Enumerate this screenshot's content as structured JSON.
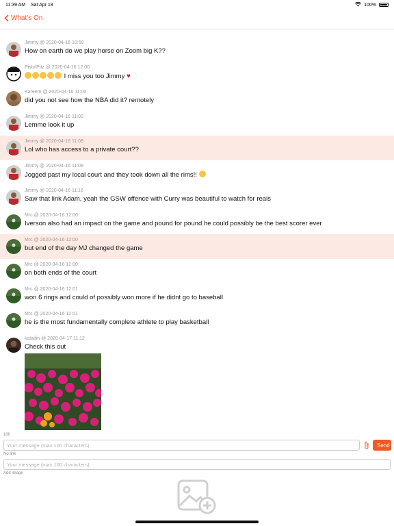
{
  "status_bar": {
    "time": "11:39 AM",
    "date": "Sat Apr 18",
    "battery": "100%"
  },
  "nav": {
    "back_label": "What's On"
  },
  "messages": [
    {
      "meta": "Jimmy @ 2020-04-16 10:59",
      "text": "How on earth do we play horse on Zoom big K??",
      "avatar": "red-jersey-avatar",
      "highlight": false
    },
    {
      "meta": "PistolPitz @ 2020-04-16 12:00",
      "text": "I miss you too Jimmy",
      "avatar": "cartoon-face-avatar",
      "highlight": false
    },
    {
      "meta": "Kareem @ 2020-04-16 11:00",
      "text": "did you not see how the NBA did it? remotely",
      "avatar": "brown-avatar",
      "highlight": false
    },
    {
      "meta": "Jimmy @ 2020-04-16 11:02",
      "text": "Lemme look it up",
      "avatar": "red-jersey-avatar",
      "highlight": false
    },
    {
      "meta": "Jimmy @ 2020-04-16 11:08",
      "text": "Lol who has access to a private court??",
      "avatar": "red-jersey-avatar",
      "highlight": true
    },
    {
      "meta": "Jimmy @ 2020-04-16 11:08",
      "text": "Jogged past my local court and they took down all the rims!!",
      "avatar": "red-jersey-avatar",
      "highlight": false
    },
    {
      "meta": "Jimmy @ 2020-04-16 11:16",
      "text": "Saw that link Adam, yeah the GSW offence with Curry was beautiful to watch for reals",
      "avatar": "red-jersey-avatar",
      "highlight": false
    },
    {
      "meta": "Mrc @ 2020-04-16 12:00",
      "text": "Iverson also had an impact on the game and pound for pound he could possibly be the best scorer ever",
      "avatar": "field-avatar",
      "highlight": false
    },
    {
      "meta": "Mrc @ 2020-04-16 12:00",
      "text": "but end of the day MJ changed the game",
      "avatar": "field-avatar",
      "highlight": true
    },
    {
      "meta": "Mrc @ 2020-04-16 12:00",
      "text": "on both ends of the court",
      "avatar": "field-avatar",
      "highlight": false
    },
    {
      "meta": "Mrc @ 2020-04-16 12:01",
      "text": "won 6 rings and could of possibly won more if he didnt go to baseball",
      "avatar": "field-avatar",
      "highlight": false
    },
    {
      "meta": "Mrc @ 2020-04-16 12:01",
      "text": "he is the most fundamentally complete athlete to play basketball",
      "avatar": "field-avatar",
      "highlight": false
    },
    {
      "meta": "kaladin @ 2020-04-17 11:12",
      "text": "Check this out",
      "avatar": "dark-avatar",
      "highlight": false
    }
  ],
  "composer": {
    "counter": "100",
    "message_placeholder": "Your message (max 100 characters)",
    "send_label": "Send",
    "no_link_label": "No link",
    "link_placeholder": "Your message (max 100 characters)",
    "add_image_label": "Add image"
  },
  "colors": {
    "accent": "#f05a22",
    "highlight": "#fde9e3"
  }
}
